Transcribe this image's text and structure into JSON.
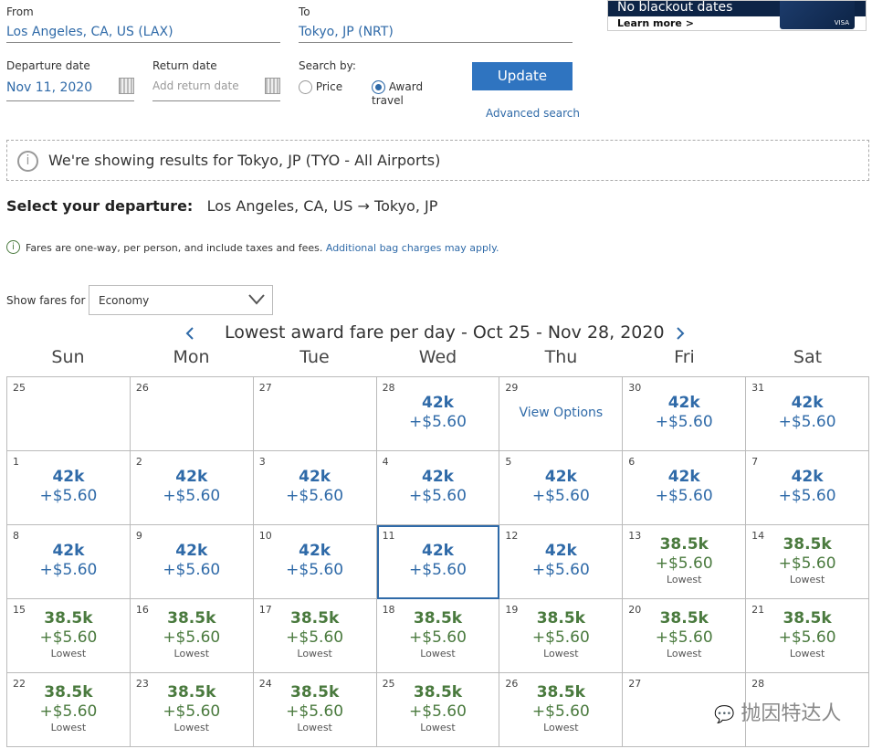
{
  "search": {
    "from_label": "From",
    "from_value": "Los Angeles, CA, US (LAX)",
    "to_label": "To",
    "to_value": "Tokyo, JP (NRT)",
    "departure_label": "Departure date",
    "departure_value": "Nov 11, 2020",
    "return_label": "Return date",
    "return_placeholder": "Add return date",
    "search_by_label": "Search by:",
    "options": [
      {
        "label": "Price",
        "selected": false
      },
      {
        "label": "Award travel",
        "selected": true
      }
    ],
    "update_label": "Update",
    "advanced_label": "Advanced search"
  },
  "ad": {
    "headline": "No blackout dates",
    "cta": "Learn more >",
    "card_brand": "VISA"
  },
  "notice": "We're showing results for Tokyo, JP (TYO - All Airports)",
  "departure": {
    "label": "Select your departure:",
    "route": "Los Angeles, CA, US → Tokyo, JP"
  },
  "fares_note": {
    "text": "Fares are one-way, per person, and include taxes and fees.",
    "link": "Additional bag charges may apply."
  },
  "fare_class": {
    "label": "Show fares for",
    "value": "Economy"
  },
  "calendar": {
    "title": "Lowest award fare per day - Oct 25 - Nov 28, 2020",
    "days": [
      "Sun",
      "Mon",
      "Tue",
      "Wed",
      "Thu",
      "Fri",
      "Sat"
    ],
    "colors": {
      "regular": "#2f6aa8",
      "lowest": "#4a7a3e"
    },
    "selected_day": "11",
    "weeks": [
      [
        {
          "day": "25"
        },
        {
          "day": "26"
        },
        {
          "day": "27"
        },
        {
          "day": "28",
          "miles": "42k",
          "fee": "+$5.60"
        },
        {
          "day": "29",
          "view": "View Options"
        },
        {
          "day": "30",
          "miles": "42k",
          "fee": "+$5.60"
        },
        {
          "day": "31",
          "miles": "42k",
          "fee": "+$5.60"
        }
      ],
      [
        {
          "day": "1",
          "miles": "42k",
          "fee": "+$5.60"
        },
        {
          "day": "2",
          "miles": "42k",
          "fee": "+$5.60"
        },
        {
          "day": "3",
          "miles": "42k",
          "fee": "+$5.60"
        },
        {
          "day": "4",
          "miles": "42k",
          "fee": "+$5.60"
        },
        {
          "day": "5",
          "miles": "42k",
          "fee": "+$5.60"
        },
        {
          "day": "6",
          "miles": "42k",
          "fee": "+$5.60"
        },
        {
          "day": "7",
          "miles": "42k",
          "fee": "+$5.60"
        }
      ],
      [
        {
          "day": "8",
          "miles": "42k",
          "fee": "+$5.60"
        },
        {
          "day": "9",
          "miles": "42k",
          "fee": "+$5.60"
        },
        {
          "day": "10",
          "miles": "42k",
          "fee": "+$5.60"
        },
        {
          "day": "11",
          "miles": "42k",
          "fee": "+$5.60"
        },
        {
          "day": "12",
          "miles": "42k",
          "fee": "+$5.60"
        },
        {
          "day": "13",
          "miles": "38.5k",
          "fee": "+$5.60",
          "tag": "Lowest"
        },
        {
          "day": "14",
          "miles": "38.5k",
          "fee": "+$5.60",
          "tag": "Lowest"
        }
      ],
      [
        {
          "day": "15",
          "miles": "38.5k",
          "fee": "+$5.60",
          "tag": "Lowest"
        },
        {
          "day": "16",
          "miles": "38.5k",
          "fee": "+$5.60",
          "tag": "Lowest"
        },
        {
          "day": "17",
          "miles": "38.5k",
          "fee": "+$5.60",
          "tag": "Lowest"
        },
        {
          "day": "18",
          "miles": "38.5k",
          "fee": "+$5.60",
          "tag": "Lowest"
        },
        {
          "day": "19",
          "miles": "38.5k",
          "fee": "+$5.60",
          "tag": "Lowest"
        },
        {
          "day": "20",
          "miles": "38.5k",
          "fee": "+$5.60",
          "tag": "Lowest"
        },
        {
          "day": "21",
          "miles": "38.5k",
          "fee": "+$5.60",
          "tag": "Lowest"
        }
      ],
      [
        {
          "day": "22",
          "miles": "38.5k",
          "fee": "+$5.60",
          "tag": "Lowest"
        },
        {
          "day": "23",
          "miles": "38.5k",
          "fee": "+$5.60",
          "tag": "Lowest"
        },
        {
          "day": "24",
          "miles": "38.5k",
          "fee": "+$5.60",
          "tag": "Lowest"
        },
        {
          "day": "25",
          "miles": "38.5k",
          "fee": "+$5.60",
          "tag": "Lowest"
        },
        {
          "day": "26",
          "miles": "38.5k",
          "fee": "+$5.60",
          "tag": "Lowest"
        },
        {
          "day": "27"
        },
        {
          "day": "28"
        }
      ]
    ]
  },
  "watermark": "抛因特达人"
}
